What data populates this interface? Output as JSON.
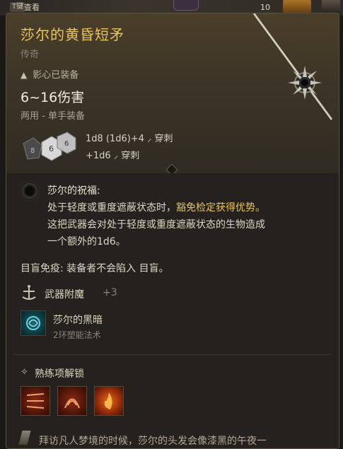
{
  "topbar": {
    "key_hint": "T键",
    "key_action": "查看",
    "count": "10"
  },
  "item": {
    "name": "莎尔的黄昏短矛",
    "rarity": "传奇",
    "equipped_note": "影心已装备",
    "damage": "6~16伤害",
    "handedness": "两用 - 单手装备",
    "dice_faces": [
      "8",
      "6",
      "6"
    ],
    "rolls": [
      {
        "dice": "1d8 (1d6)+4",
        "type": "穿刺"
      },
      {
        "dice": "+1d6",
        "type": "穿刺"
      }
    ]
  },
  "blessing": {
    "title": "莎尔的祝福:",
    "line1_a": "处于轻度或重度遮蔽状态时，",
    "line1_b": "豁免检定获得优势。",
    "line2": "这把武器会对处于轻度或重度遮蔽状态的生物造成",
    "line3": "一个额外的1d6。"
  },
  "immunity": "目盲免疫: 装备者不会陷入 目盲。",
  "enchantment": {
    "label": "武器附魔",
    "value": "+3"
  },
  "spell": {
    "name": "莎尔的黑暗",
    "level": "2环塑能法术"
  },
  "proficiency": {
    "label": "熟练项解锁"
  },
  "flavor": "拜访凡人梦境的时候，莎尔的头发会像漆黑的午夜一",
  "colors": {
    "title": "#e9c45c",
    "highlight": "#e9c45c"
  },
  "icons": [
    "warning-icon",
    "dice-icon",
    "pierce-icon",
    "blessing-icon",
    "enchant-icon",
    "spell-icon",
    "proficiency-icon",
    "flavor-icon"
  ]
}
